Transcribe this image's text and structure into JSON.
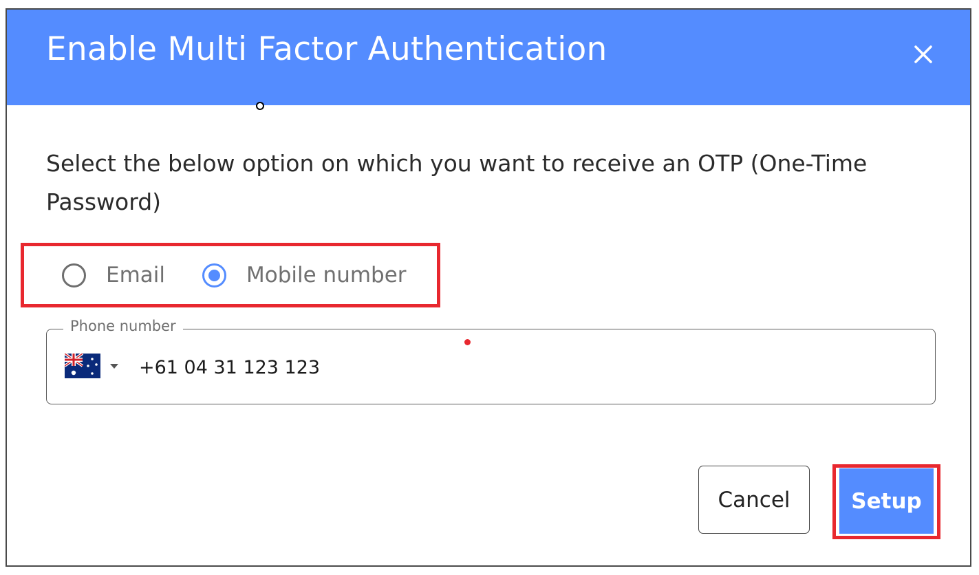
{
  "dialog": {
    "title": "Enable Multi Factor Authentication",
    "close_icon": "close-icon",
    "instruction": "Select the below option on which you want to receive an OTP (One-Time Password)",
    "otp_options": [
      {
        "label": "Email",
        "selected": false
      },
      {
        "label": "Mobile number",
        "selected": true
      }
    ],
    "phone": {
      "legend": "Phone number",
      "country_flag": "australia-flag-icon",
      "value": "+61 04 31 123 123"
    },
    "buttons": {
      "cancel_label": "Cancel",
      "setup_label": "Setup"
    }
  },
  "colors": {
    "header": "#548cff",
    "accent": "#548cff",
    "highlight": "#e8282f"
  }
}
